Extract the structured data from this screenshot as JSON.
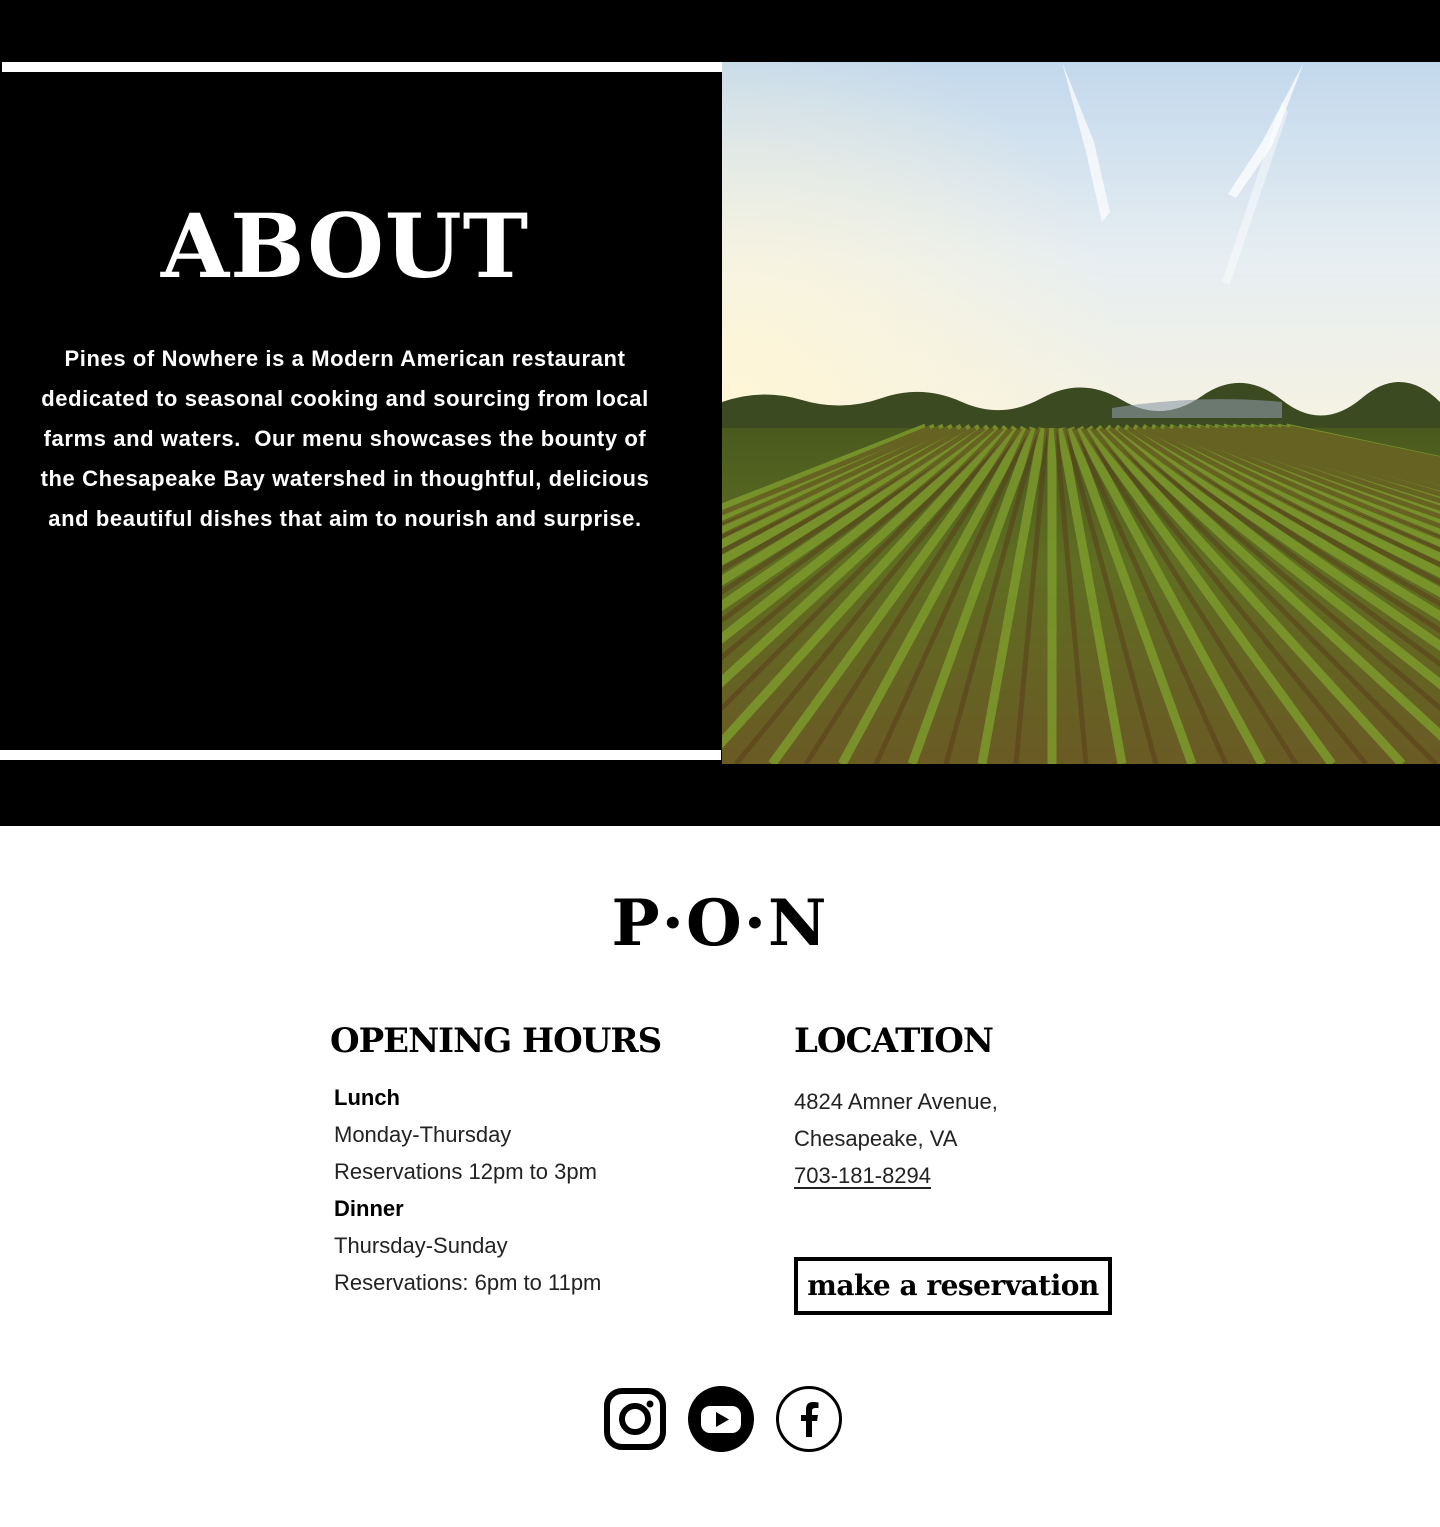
{
  "about": {
    "heading": "ABOUT",
    "body": "Pines of Nowhere is a Modern American restaurant dedicated to seasonal cooking and sourcing from local farms and waters.  Our menu showcases the bounty of the Chesapeake Bay watershed in thoughtful, delicious and beautiful dishes that aim to nourish and surprise."
  },
  "footer": {
    "logo": "P·O·N",
    "hours": {
      "heading": "OPENING HOURS",
      "lunch_label": "Lunch",
      "lunch_days": "Monday-Thursday",
      "lunch_times": "Reservations 12pm to 3pm",
      "dinner_label": "Dinner",
      "dinner_days": "Thursday-Sunday",
      "dinner_times": "Reservations: 6pm to 11pm"
    },
    "location": {
      "heading": "LOCATION",
      "address_line1": "4824 Amner Avenue,",
      "address_line2": "Chesapeake, VA",
      "phone": "703-181-8294"
    },
    "reserve_button": "make a reservation",
    "social": [
      "instagram-icon",
      "youtube-icon",
      "facebook-icon"
    ]
  },
  "colors": {
    "background_dark": "#000000",
    "background_light": "#ffffff",
    "text_light": "#ffffff",
    "text_dark": "#000000"
  }
}
